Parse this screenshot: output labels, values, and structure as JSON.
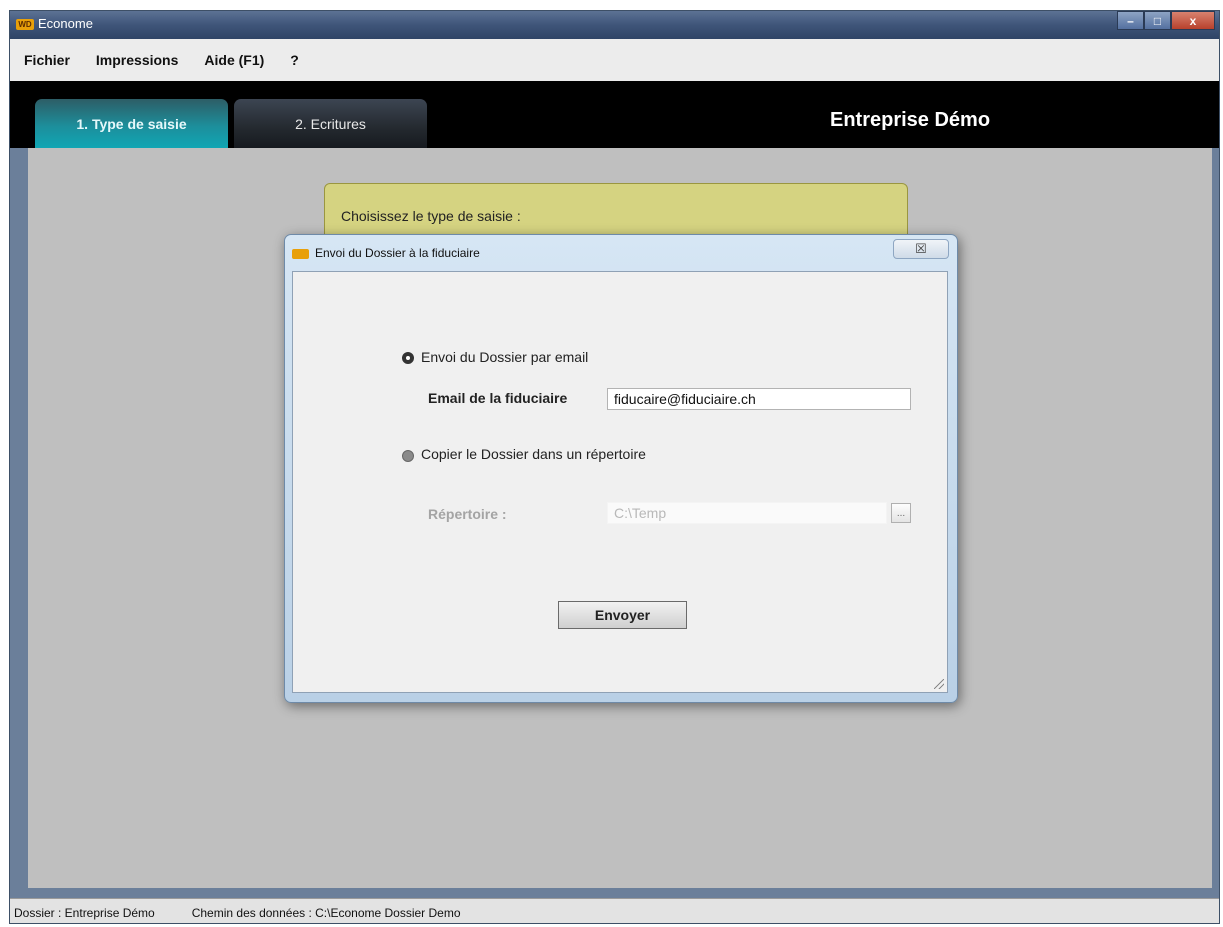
{
  "window": {
    "title": "Econome",
    "logo_text": "WD",
    "controls": {
      "minimize": "–",
      "maximize": "□",
      "close": "x"
    }
  },
  "menu": {
    "items": [
      "Fichier",
      "Impressions",
      "Aide (F1)",
      "?"
    ]
  },
  "tabs": {
    "items": [
      {
        "label": "1. Type de saisie",
        "active": true
      },
      {
        "label": "2. Ecritures",
        "active": false
      }
    ]
  },
  "header": {
    "company": "Entreprise Démo"
  },
  "info_panel": {
    "prompt": "Choisissez le type de saisie :"
  },
  "dialog": {
    "title": "Envoi du Dossier à la fiduciaire",
    "close_glyph": "☒",
    "option_email": {
      "label": "Envoi du Dossier par email",
      "selected": true
    },
    "email_field": {
      "label": "Email de la fiduciaire",
      "value": "fiducaire@fiduciaire.ch"
    },
    "option_copy": {
      "label": "Copier le Dossier dans un répertoire",
      "selected": false
    },
    "directory_field": {
      "label": "Répertoire :",
      "value": "C:\\Temp",
      "browse_label": "..."
    },
    "send_button": "Envoyer"
  },
  "status_bar": {
    "dossier": "Dossier : Entreprise Démo",
    "data_path": "Chemin des données : C:\\Econome Dossier Demo"
  }
}
